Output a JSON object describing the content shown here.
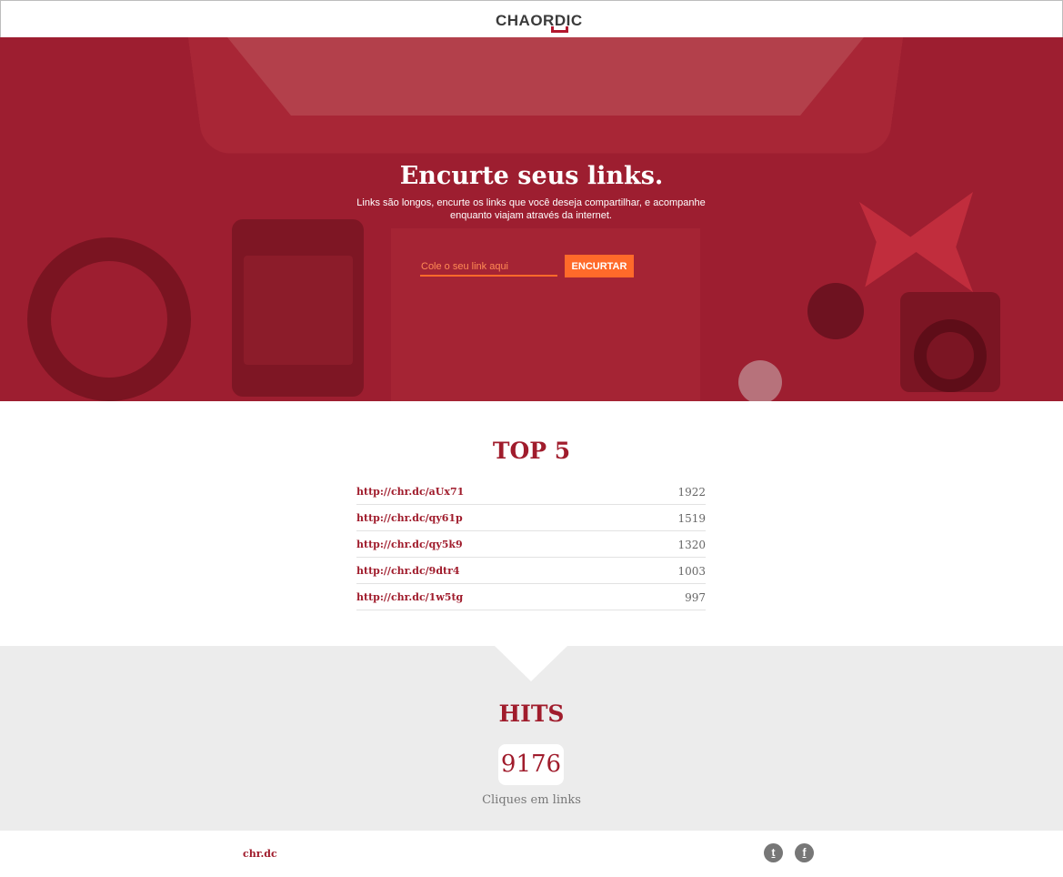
{
  "brand": {
    "logo_text": "CHAORDIC",
    "accent": "#a01c2c",
    "orange": "#ff6a2a"
  },
  "hero": {
    "title": "Encurte seus links.",
    "subtitle": "Links são longos, encurte os links que você deseja compartilhar, e acompanhe enquanto viajam através da internet.",
    "input_placeholder": "Cole o seu link aqui",
    "input_value": "",
    "button_label": "ENCURTAR"
  },
  "top5": {
    "title": "TOP 5",
    "items": [
      {
        "url": "http://chr.dc/aUx71",
        "count": "1922"
      },
      {
        "url": "http://chr.dc/qy61p",
        "count": "1519"
      },
      {
        "url": "http://chr.dc/qy5k9",
        "count": "1320"
      },
      {
        "url": "http://chr.dc/9dtr4",
        "count": "1003"
      },
      {
        "url": "http://chr.dc/1w5tg",
        "count": "997"
      }
    ]
  },
  "hits": {
    "title": "HITS",
    "value": "9176",
    "label": "Cliques em links"
  },
  "footer": {
    "brand_link": "chr.dc",
    "social": [
      {
        "icon": "twitter-icon",
        "glyph": "t"
      },
      {
        "icon": "facebook-icon",
        "glyph": "f"
      }
    ]
  }
}
